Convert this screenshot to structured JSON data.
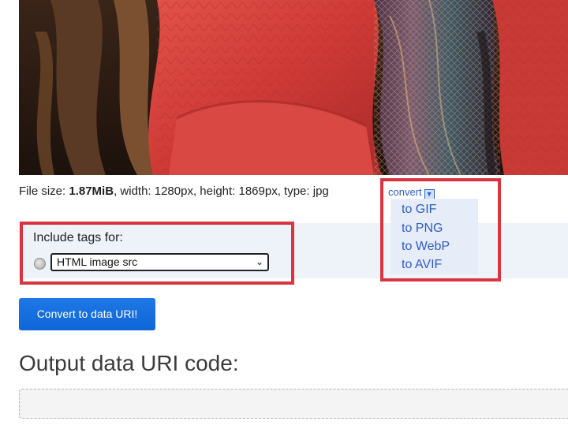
{
  "preview": {
    "description_icon": "image-preview"
  },
  "file_info": {
    "size_label": "File size: ",
    "size_value": "1.87MiB",
    "rest": ", width: 1280px, height: 1869px, type: jpg"
  },
  "convert_menu": {
    "toggle_label": "convert",
    "toggle_icon": "download-icon",
    "items": [
      "to GIF",
      "to PNG",
      "to WebP",
      "to AVIF"
    ]
  },
  "include_tags": {
    "label": "Include tags for:",
    "selected_option": "HTML image src"
  },
  "convert_button": {
    "label": "Convert to data URI!"
  },
  "output": {
    "heading": "Output data URI code:",
    "value": ""
  },
  "colors": {
    "highlight": "#d9343f",
    "link": "#2e5bc9",
    "button": "#1a73e8"
  }
}
